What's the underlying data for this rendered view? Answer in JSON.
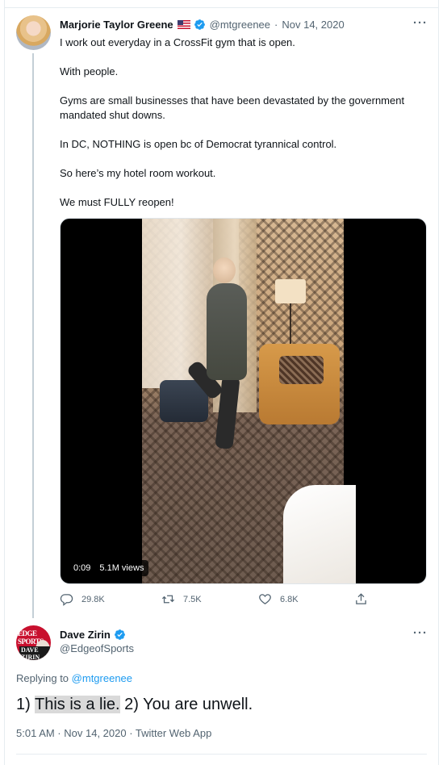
{
  "tweet1": {
    "name": "Marjorie Taylor Greene",
    "handle": "@mtgreenee",
    "separator": "·",
    "date": "Nov 14, 2020",
    "more": "···",
    "paragraphs": [
      "I work out everyday in a CrossFit gym that is open.",
      "With people.",
      "Gyms are small businesses that have been devastated by the government mandated shut downs.",
      "In DC, NOTHING is open bc of Democrat tyrannical control.",
      "So here’s my hotel room workout.",
      "We must FULLY reopen!"
    ],
    "video": {
      "duration": "0:09",
      "views": "5.1M views"
    },
    "actions": {
      "replies": "29.8K",
      "retweets": "7.5K",
      "likes": "6.8K"
    }
  },
  "tweet2": {
    "name": "Dave Zirin",
    "handle": "@EdgeofSports",
    "more": "···",
    "avatar_text": [
      "EDGE",
      "SPORTS",
      "DAVE ZIRIN"
    ],
    "replying_prefix": "Replying to",
    "replying_handle": "@mtgreenee",
    "text_prefix": "1)",
    "text_highlight": "This is a lie.",
    "text_suffix": "2) You are unwell.",
    "meta": "5:01 AM · Nov 14, 2020 · Twitter Web App"
  },
  "colors": {
    "verified": "#1d9bf0",
    "muted": "#536471",
    "link": "#1d9bf0"
  }
}
